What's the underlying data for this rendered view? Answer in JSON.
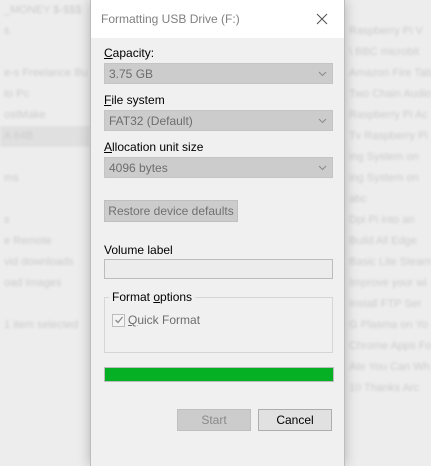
{
  "dialog": {
    "title": "Formatting USB Drive (F:)",
    "capacity": {
      "label_key": "C",
      "label_rest": "apacity:",
      "value": "3.75 GB"
    },
    "file_system": {
      "label_key": "F",
      "label_rest": "ile system",
      "value": "FAT32 (Default)"
    },
    "allocation": {
      "label_key": "A",
      "label_rest": "llocation unit size",
      "value": "4096 bytes"
    },
    "restore_label": "Restore device defaults",
    "volume_label": "Volume label",
    "volume_value": "",
    "format_options": {
      "legend_key": "F",
      "legend_pre": "Format ",
      "legend_rest": "ptions",
      "legend_mid": "o",
      "quick_format_key": "Q",
      "quick_format_rest": "uick Format",
      "quick_format_checked": true
    },
    "progress_fraction": 1.0,
    "start_label": "Start",
    "cancel_label": "Cancel"
  },
  "colors": {
    "progress": "#06b025"
  },
  "background": {
    "left_lines": [
      "_MONEY $-$$$",
      "s",
      "",
      "e-s Freelance Bu",
      "to Pc",
      "ostMake",
      "A 64B",
      "",
      "ms",
      "",
      "s",
      "e Remote",
      "vid downloads",
      "oad Images",
      "",
      "1 item selected"
    ],
    "right_lines": [
      "",
      "Raspberry Pi V",
      "\\ BBC microbit",
      "Amazon Fire Tab",
      "Two Chain Audio",
      "Raspberry Pi Ac",
      "Tv Raspberry Pi",
      "ing System on",
      "ing System on",
      "abc",
      "Dpi Pi into an",
      "Build All Edge",
      "Basic Lite Steam",
      "Improve your wi",
      "Install FTP Ser",
      "G Plasma on Yo",
      "Chrome Apps Fo",
      "Ate You Can Wh",
      "10 Thanks Arc"
    ],
    "selected_left_index": 6
  }
}
